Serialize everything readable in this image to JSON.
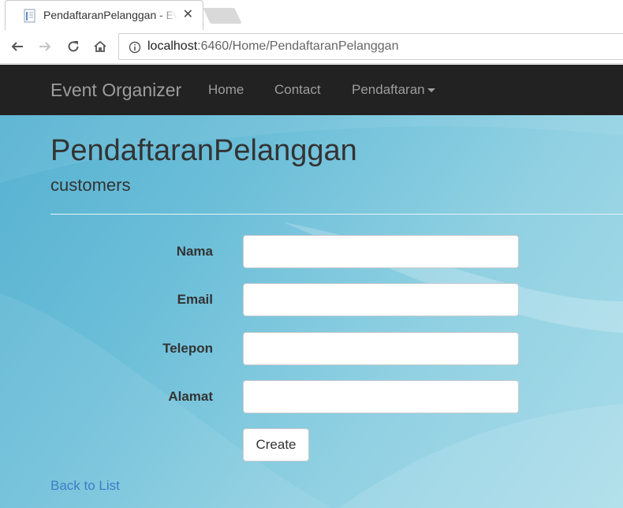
{
  "browser": {
    "tab_title": "PendaftaranPelanggan - Event Organizer",
    "url_host": "localhost",
    "url_rest": ":6460/Home/PendaftaranPelanggan",
    "icons": [
      "document-favicon-icon",
      "close-icon",
      "back-arrow-icon",
      "forward-arrow-icon",
      "reload-icon",
      "home-icon",
      "info-icon"
    ]
  },
  "navbar": {
    "brand": "Event Organizer",
    "links": [
      "Home",
      "Contact",
      "Pendaftaran"
    ]
  },
  "page": {
    "title": "PendaftaranPelanggan",
    "subtitle": "customers"
  },
  "form": {
    "fields": [
      {
        "label": "Nama",
        "value": ""
      },
      {
        "label": "Email",
        "value": ""
      },
      {
        "label": "Telepon",
        "value": ""
      },
      {
        "label": "Alamat",
        "value": ""
      }
    ],
    "submit_label": "Create"
  },
  "back_link": "Back to List",
  "colors": {
    "navbar_bg": "#222222",
    "navbar_text": "#9d9d9d",
    "link": "#3b7fc4",
    "page_bg_accent": "#6dbfd9"
  }
}
